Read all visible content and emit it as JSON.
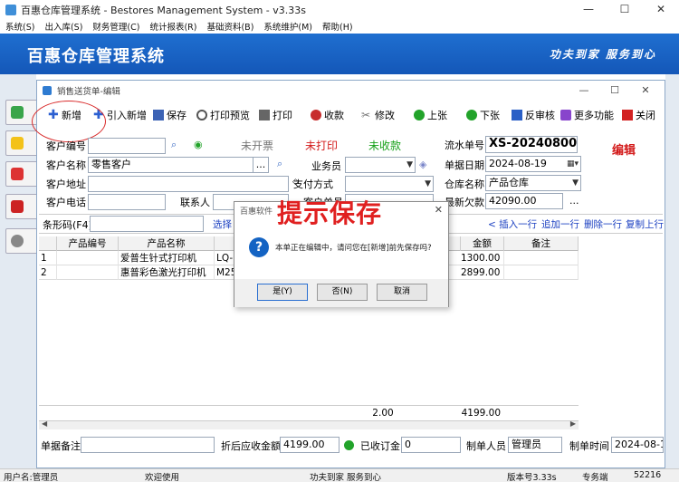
{
  "window": {
    "title": "百惠仓库管理系统 - Bestores Management System - v3.33s",
    "minimize": "—",
    "maximize": "☐",
    "close": "✕"
  },
  "menu": [
    "系统(S)",
    "出入库(S)",
    "财务管理(C)",
    "统计报表(R)",
    "基础资料(B)",
    "系统维护(M)",
    "帮助(H)"
  ],
  "banner": {
    "title": "百惠仓库管理系统",
    "slogan": "功夫到家 服务到心"
  },
  "child": {
    "title": "销售送货单-编辑",
    "edit_tag": "编辑",
    "toolbar": [
      {
        "label": "新增",
        "icon": "plus-icon",
        "color": "#2b5fd1"
      },
      {
        "label": "引入新增",
        "icon": "import-plus-icon",
        "color": "#2b5fd1"
      },
      {
        "label": "保存",
        "icon": "save-icon",
        "color": "#3c63b5"
      },
      {
        "label": "打印预览",
        "icon": "print-preview-icon",
        "color": "#555"
      },
      {
        "label": "打印",
        "icon": "print-icon",
        "color": "#444"
      },
      {
        "label": "收款",
        "icon": "receive-payment-icon",
        "color": "#c72d2d"
      },
      {
        "label": "修改",
        "icon": "edit-icon",
        "color": "#777"
      },
      {
        "label": "上张",
        "icon": "prev-icon",
        "color": "#22a32a"
      },
      {
        "label": "下张",
        "icon": "next-icon",
        "color": "#22a32a"
      },
      {
        "label": "反审核",
        "icon": "unapprove-icon",
        "color": "#2a5fc6"
      },
      {
        "label": "更多功能",
        "icon": "more-icon",
        "color": "#8844cc"
      },
      {
        "label": "关闭",
        "icon": "close-doc-icon",
        "color": "#d22222"
      }
    ],
    "form": {
      "customer_code_label": "客户编号",
      "customer_name_label": "客户名称",
      "customer_name_value": "零售客户",
      "customer_addr_label": "客户地址",
      "customer_phone_label": "客户电话",
      "contact_label": "联系人",
      "invoice_status": "未开票",
      "print_status": "未打印",
      "payment_status": "未收款",
      "salesman_label": "业务员",
      "pay_method_label": "支付方式",
      "customer_order_label": "客户单号",
      "serial_label": "流水单号",
      "serial_value": "XS-202408006",
      "date_label": "单据日期",
      "date_value": "2024-08-19",
      "warehouse_label": "仓库名称",
      "warehouse_value": "产品仓库",
      "balance_label": "最新欠款",
      "balance_value": "42090.00",
      "ellipsis": "...",
      "barcode_label": "条形码(F4)",
      "select_link": "选择"
    },
    "row_actions": [
      "< 插入一行",
      "追加一行",
      "删除一行",
      "复制上行"
    ],
    "table": {
      "columns": [
        "",
        "产品编号",
        "产品名称",
        "",
        "金额",
        "备注"
      ],
      "rows": [
        {
          "no": "1",
          "code": "",
          "name": "爱普生针式打印机",
          "model": "LQ-6",
          "amount": "1300.00",
          "remark": ""
        },
        {
          "no": "2",
          "code": "",
          "name": "惠普彩色激光打印机",
          "model": "M25",
          "amount": "2899.00",
          "remark": ""
        }
      ],
      "total_qty": "2.00",
      "total_amount": "4199.00"
    },
    "bottom": {
      "remark_label": "单据备注",
      "discount_label": "折后应收金额",
      "discount_value": "4199.00",
      "received_label": "已收订金",
      "received_value": "0",
      "maker_label": "制单人员",
      "maker_value": "管理员",
      "make_time_label": "制单时间",
      "make_time_value": "2024-08-19"
    }
  },
  "dialog": {
    "title": "百惠软件",
    "message": "本单正在编辑中，请问您在[新增]前先保存吗?",
    "yes": "是(Y)",
    "no": "否(N)",
    "cancel": "取消",
    "hint": "提示保存"
  },
  "status": {
    "user": "用户名:管理员",
    "welcome": "欢迎使用",
    "slogan": "功夫到家 服务到心",
    "version": "版本号3.33s",
    "edition": "专务端",
    "code": "52216"
  }
}
